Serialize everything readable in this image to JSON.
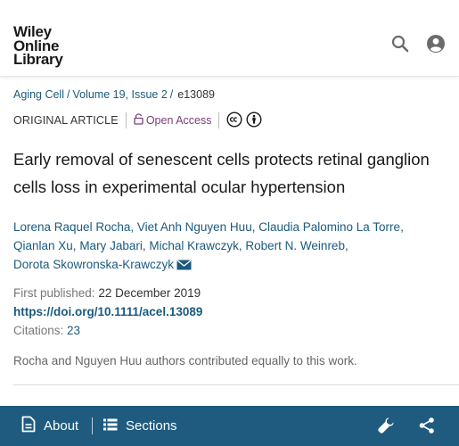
{
  "header": {
    "logo_lines": [
      "Wiley",
      "Online",
      "Library"
    ],
    "icons": [
      "search-icon",
      "account-icon"
    ]
  },
  "breadcrumb": {
    "journal": "Aging Cell",
    "volume": "Volume 19, Issue 2",
    "article_id": "e13089"
  },
  "article": {
    "type": "ORIGINAL ARTICLE",
    "access": "Open Access",
    "title": "Early removal of senescent cells protects retinal ganglion cells loss in experimental ocular hypertension",
    "authors": [
      "Lorena Raquel Rocha",
      "Viet Anh Nguyen Huu",
      "Claudia Palomino La Torre",
      "Qianlan Xu",
      "Mary Jabari",
      "Michal Krawczyk",
      "Robert N. Weinreb",
      "Dorota Skowronska-Krawczyk"
    ],
    "first_published_label": "First published:",
    "first_published": "22 December 2019",
    "doi": "https://doi.org/10.1111/acel.13089",
    "citations_label": "Citations:",
    "citations": "23",
    "note": "Rocha and Nguyen Huu authors contributed equally to this work."
  },
  "bottom_bar": {
    "about_label": "About",
    "sections_label": "Sections"
  },
  "colors": {
    "link": "#1b5a7d",
    "open_access": "#7b3f7e",
    "bottom_bar": "#1f5b7e"
  }
}
